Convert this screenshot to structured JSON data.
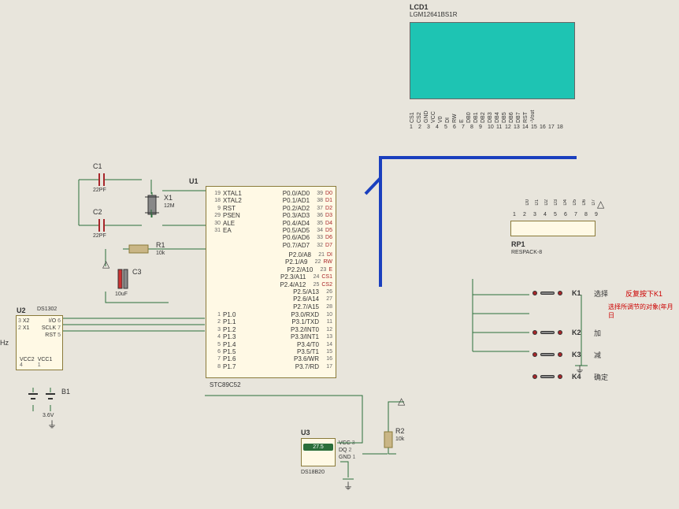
{
  "lcd": {
    "ref": "LCD1",
    "part": "LGM12641BS1R",
    "pins": [
      "CS1",
      "CS2",
      "GND",
      "VCC",
      "V0",
      "DI",
      "RW",
      "E",
      "DB0",
      "DB1",
      "DB2",
      "DB3",
      "DB4",
      "DB5",
      "DB6",
      "DB7",
      "RST",
      "-Vout"
    ],
    "nums": [
      "1",
      "2",
      "3",
      "4",
      "5",
      "6",
      "7",
      "8",
      "9",
      "10",
      "11",
      "12",
      "13",
      "14",
      "15",
      "16",
      "17",
      "18"
    ]
  },
  "u1": {
    "ref": "U1",
    "part": "STC89C52",
    "left_pins_top": [
      {
        "n": "19",
        "name": "XTAL1"
      },
      {
        "n": "18",
        "name": "XTAL2"
      },
      {
        "n": "9",
        "name": "RST"
      },
      {
        "n": "29",
        "name": "PSEN"
      },
      {
        "n": "30",
        "name": "ALE"
      },
      {
        "n": "31",
        "name": "EA"
      }
    ],
    "left_pins_bot": [
      {
        "n": "1",
        "name": "P1.0"
      },
      {
        "n": "2",
        "name": "P1.1"
      },
      {
        "n": "3",
        "name": "P1.2"
      },
      {
        "n": "4",
        "name": "P1.3"
      },
      {
        "n": "5",
        "name": "P1.4"
      },
      {
        "n": "6",
        "name": "P1.5"
      },
      {
        "n": "7",
        "name": "P1.6"
      },
      {
        "n": "8",
        "name": "P1.7"
      }
    ],
    "right_pins_top": [
      {
        "n": "39",
        "name": "P0.0/AD0",
        "net": "D0"
      },
      {
        "n": "38",
        "name": "P0.1/AD1",
        "net": "D1"
      },
      {
        "n": "37",
        "name": "P0.2/AD2",
        "net": "D2"
      },
      {
        "n": "36",
        "name": "P0.3/AD3",
        "net": "D3"
      },
      {
        "n": "35",
        "name": "P0.4/AD4",
        "net": "D4"
      },
      {
        "n": "34",
        "name": "P0.5/AD5",
        "net": "D5"
      },
      {
        "n": "33",
        "name": "P0.6/AD6",
        "net": "D6"
      },
      {
        "n": "32",
        "name": "P0.7/AD7",
        "net": "D7"
      }
    ],
    "right_pins_mid": [
      {
        "n": "21",
        "name": "P2.0/A8",
        "net": "DI"
      },
      {
        "n": "22",
        "name": "P2.1/A9",
        "net": "RW"
      },
      {
        "n": "23",
        "name": "P2.2/A10",
        "net": "E"
      },
      {
        "n": "24",
        "name": "P2.3/A11",
        "net": "CS1"
      },
      {
        "n": "25",
        "name": "P2.4/A12",
        "net": "CS2"
      },
      {
        "n": "26",
        "name": "P2.5/A13",
        "net": ""
      },
      {
        "n": "27",
        "name": "P2.6/A14",
        "net": ""
      },
      {
        "n": "28",
        "name": "P2.7/A15",
        "net": ""
      }
    ],
    "right_pins_bot": [
      {
        "n": "10",
        "name": "P3.0/RXD"
      },
      {
        "n": "11",
        "name": "P3.1/TXD"
      },
      {
        "n": "12",
        "name": "P3.2/INT0"
      },
      {
        "n": "13",
        "name": "P3.3/INT1"
      },
      {
        "n": "14",
        "name": "P3.4/T0"
      },
      {
        "n": "15",
        "name": "P3.5/T1"
      },
      {
        "n": "16",
        "name": "P3.6/WR"
      },
      {
        "n": "17",
        "name": "P3.7/RD"
      }
    ]
  },
  "u2": {
    "ref": "U2",
    "part": "DS1302",
    "right_pins": [
      {
        "n": "6",
        "name": "I/O"
      },
      {
        "n": "7",
        "name": "SCLK"
      },
      {
        "n": "5",
        "name": "RST"
      }
    ],
    "left_pins": [
      {
        "n": "3",
        "name": "X2"
      },
      {
        "n": "2",
        "name": "X1"
      }
    ],
    "bot_pins": [
      {
        "n": "4",
        "name": "VCC2"
      },
      {
        "n": "1",
        "name": "VCC1"
      }
    ]
  },
  "u3": {
    "ref": "U3",
    "part": "DS18B20",
    "display": "27.5",
    "pins": [
      {
        "n": "3",
        "name": "VCC"
      },
      {
        "n": "2",
        "name": "DQ"
      },
      {
        "n": "1",
        "name": "GND"
      }
    ]
  },
  "rp1": {
    "ref": "RP1",
    "part": "RESPACK-8",
    "pins": [
      "1",
      "2",
      "3",
      "4",
      "5",
      "6",
      "7",
      "8",
      "9"
    ],
    "nets": [
      "",
      "D0",
      "D1",
      "D2",
      "D3",
      "D4",
      "D5",
      "D6",
      "D7"
    ]
  },
  "clock": {
    "c1": {
      "ref": "C1",
      "val": "22PF"
    },
    "c2": {
      "ref": "C2",
      "val": "22PF"
    },
    "x1": {
      "ref": "X1",
      "val": "12M"
    },
    "r1": {
      "ref": "R1",
      "val": "10k"
    },
    "c3": {
      "ref": "C3",
      "val": "10uF"
    },
    "b1": {
      "ref": "B1",
      "val": "3.6V"
    },
    "r2": {
      "ref": "R2",
      "val": "10k"
    }
  },
  "btns": [
    {
      "ref": "K1",
      "lbl": "选择",
      "note": "反复按下K1",
      "note2": "选择所调节的对象(年月日"
    },
    {
      "ref": "K2",
      "lbl": "加",
      "note": "",
      "note2": ""
    },
    {
      "ref": "K3",
      "lbl": "减",
      "note": "",
      "note2": ""
    },
    {
      "ref": "K4",
      "lbl": "确定",
      "note": "",
      "note2": ""
    }
  ],
  "x2_label": "Hz"
}
